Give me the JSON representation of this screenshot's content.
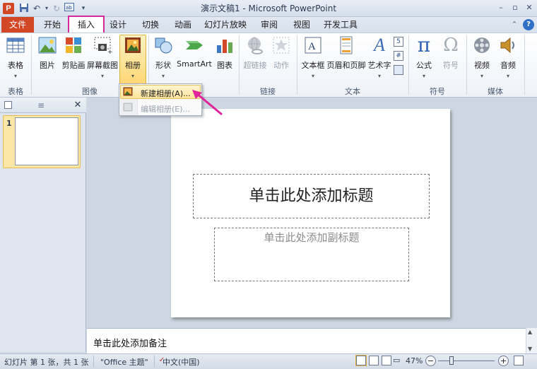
{
  "window": {
    "title": "演示文稿1 - Microsoft PowerPoint",
    "app_icon_letter": "P",
    "minimize": "–",
    "maximize": "▫",
    "close": "✕"
  },
  "tabs": {
    "file": "文件",
    "items": [
      "开始",
      "插入",
      "设计",
      "切换",
      "动画",
      "幻灯片放映",
      "审阅",
      "视图",
      "开发工具"
    ],
    "active": "插入",
    "accent_file": "#d24726",
    "highlight_color": "#d42a9c"
  },
  "ribbon": {
    "groups": {
      "tables": "表格",
      "images": "图像",
      "links": "链接",
      "text": "文本",
      "symbols": "符号",
      "media": "媒体"
    },
    "buttons": {
      "table": "表格",
      "picture": "图片",
      "clipart": "剪贴画",
      "screenshot": "屏幕截图",
      "album": "相册",
      "shapes": "形状",
      "smartart": "SmartArt",
      "chart": "图表",
      "hyperlink": "超链接",
      "action": "动作",
      "textbox": "文本框",
      "header_footer": "页眉和页脚",
      "wordart": "艺术字",
      "equation": "公式",
      "symbol": "符号",
      "video": "视频",
      "audio": "音频"
    },
    "symbol_glyphs": {
      "equation": "π",
      "symbol": "Ω",
      "wordart": "A"
    }
  },
  "album_menu": {
    "new_album": "新建相册(A)...",
    "edit_album": "编辑相册(E)..."
  },
  "slide_pane": {
    "slide_number": "1"
  },
  "slide": {
    "title_placeholder": "单击此处添加标题",
    "subtitle_placeholder": "单击此处添加副标题"
  },
  "notes": {
    "placeholder": "单击此处添加备注"
  },
  "statusbar": {
    "slide_info": "幻灯片 第 1 张，共 1 张",
    "theme": "\"Office 主题\"",
    "language": "中文(中国)",
    "zoom": "47%",
    "zoom_minus": "−",
    "zoom_plus": "+"
  }
}
